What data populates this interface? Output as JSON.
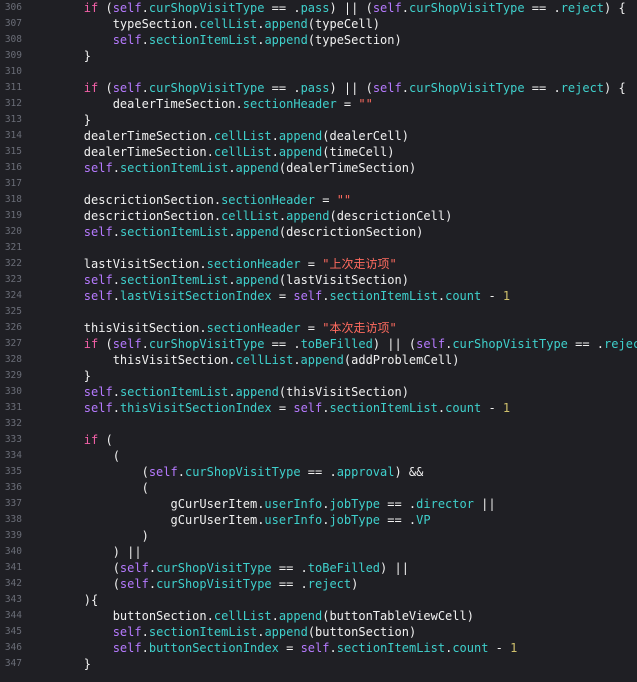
{
  "editor": {
    "colors": {
      "background": "#1f1f24",
      "line_number": "#6a6d77",
      "plain": "#f1f1f1",
      "keyword": "#f05fa6",
      "self": "#b67aff",
      "property": "#3fd0cc",
      "string": "#ff6b5f",
      "number": "#cfc06c"
    },
    "lines": [
      {
        "n": "306",
        "tokens": [
          [
            "plain",
            "        "
          ],
          [
            "kw",
            "if"
          ],
          [
            "plain",
            " ("
          ],
          [
            "self",
            "self"
          ],
          [
            "plain",
            "."
          ],
          [
            "prop",
            "curShopVisitType"
          ],
          [
            "plain",
            " == ."
          ],
          [
            "prop",
            "pass"
          ],
          [
            "plain",
            ") || ("
          ],
          [
            "self",
            "self"
          ],
          [
            "plain",
            "."
          ],
          [
            "prop",
            "curShopVisitType"
          ],
          [
            "plain",
            " == ."
          ],
          [
            "prop",
            "reject"
          ],
          [
            "plain",
            ") {"
          ]
        ]
      },
      {
        "n": "307",
        "tokens": [
          [
            "plain",
            "            typeSection."
          ],
          [
            "prop",
            "cellList"
          ],
          [
            "plain",
            "."
          ],
          [
            "prop",
            "append"
          ],
          [
            "plain",
            "(typeCell)"
          ]
        ]
      },
      {
        "n": "308",
        "tokens": [
          [
            "plain",
            "            "
          ],
          [
            "self",
            "self"
          ],
          [
            "plain",
            "."
          ],
          [
            "prop",
            "sectionItemList"
          ],
          [
            "plain",
            "."
          ],
          [
            "prop",
            "append"
          ],
          [
            "plain",
            "(typeSection)"
          ]
        ]
      },
      {
        "n": "309",
        "tokens": [
          [
            "plain",
            "        }"
          ]
        ]
      },
      {
        "n": "310",
        "tokens": []
      },
      {
        "n": "311",
        "tokens": [
          [
            "plain",
            "        "
          ],
          [
            "kw",
            "if"
          ],
          [
            "plain",
            " ("
          ],
          [
            "self",
            "self"
          ],
          [
            "plain",
            "."
          ],
          [
            "prop",
            "curShopVisitType"
          ],
          [
            "plain",
            " == ."
          ],
          [
            "prop",
            "pass"
          ],
          [
            "plain",
            ") || ("
          ],
          [
            "self",
            "self"
          ],
          [
            "plain",
            "."
          ],
          [
            "prop",
            "curShopVisitType"
          ],
          [
            "plain",
            " == ."
          ],
          [
            "prop",
            "reject"
          ],
          [
            "plain",
            ") {"
          ]
        ]
      },
      {
        "n": "312",
        "tokens": [
          [
            "plain",
            "            dealerTimeSection."
          ],
          [
            "prop",
            "sectionHeader"
          ],
          [
            "plain",
            " = "
          ],
          [
            "str",
            "\"\""
          ]
        ]
      },
      {
        "n": "313",
        "tokens": [
          [
            "plain",
            "        }"
          ]
        ]
      },
      {
        "n": "314",
        "tokens": [
          [
            "plain",
            "        dealerTimeSection."
          ],
          [
            "prop",
            "cellList"
          ],
          [
            "plain",
            "."
          ],
          [
            "prop",
            "append"
          ],
          [
            "plain",
            "(dealerCell)"
          ]
        ]
      },
      {
        "n": "315",
        "tokens": [
          [
            "plain",
            "        dealerTimeSection."
          ],
          [
            "prop",
            "cellList"
          ],
          [
            "plain",
            "."
          ],
          [
            "prop",
            "append"
          ],
          [
            "plain",
            "(timeCell)"
          ]
        ]
      },
      {
        "n": "316",
        "tokens": [
          [
            "plain",
            "        "
          ],
          [
            "self",
            "self"
          ],
          [
            "plain",
            "."
          ],
          [
            "prop",
            "sectionItemList"
          ],
          [
            "plain",
            "."
          ],
          [
            "prop",
            "append"
          ],
          [
            "plain",
            "(dealerTimeSection)"
          ]
        ]
      },
      {
        "n": "317",
        "tokens": []
      },
      {
        "n": "318",
        "tokens": [
          [
            "plain",
            "        descrictionSection."
          ],
          [
            "prop",
            "sectionHeader"
          ],
          [
            "plain",
            " = "
          ],
          [
            "str",
            "\"\""
          ]
        ]
      },
      {
        "n": "319",
        "tokens": [
          [
            "plain",
            "        descrictionSection."
          ],
          [
            "prop",
            "cellList"
          ],
          [
            "plain",
            "."
          ],
          [
            "prop",
            "append"
          ],
          [
            "plain",
            "(descrictionCell)"
          ]
        ]
      },
      {
        "n": "320",
        "tokens": [
          [
            "plain",
            "        "
          ],
          [
            "self",
            "self"
          ],
          [
            "plain",
            "."
          ],
          [
            "prop",
            "sectionItemList"
          ],
          [
            "plain",
            "."
          ],
          [
            "prop",
            "append"
          ],
          [
            "plain",
            "(descrictionSection)"
          ]
        ]
      },
      {
        "n": "321",
        "tokens": []
      },
      {
        "n": "322",
        "tokens": [
          [
            "plain",
            "        lastVisitSection."
          ],
          [
            "prop",
            "sectionHeader"
          ],
          [
            "plain",
            " = "
          ],
          [
            "str",
            "\"上次走访项\""
          ]
        ]
      },
      {
        "n": "323",
        "tokens": [
          [
            "plain",
            "        "
          ],
          [
            "self",
            "self"
          ],
          [
            "plain",
            "."
          ],
          [
            "prop",
            "sectionItemList"
          ],
          [
            "plain",
            "."
          ],
          [
            "prop",
            "append"
          ],
          [
            "plain",
            "(lastVisitSection)"
          ]
        ]
      },
      {
        "n": "324",
        "tokens": [
          [
            "plain",
            "        "
          ],
          [
            "self",
            "self"
          ],
          [
            "plain",
            "."
          ],
          [
            "prop",
            "lastVisitSectionIndex"
          ],
          [
            "plain",
            " = "
          ],
          [
            "self",
            "self"
          ],
          [
            "plain",
            "."
          ],
          [
            "prop",
            "sectionItemList"
          ],
          [
            "plain",
            "."
          ],
          [
            "prop",
            "count"
          ],
          [
            "plain",
            " - "
          ],
          [
            "num",
            "1"
          ]
        ]
      },
      {
        "n": "325",
        "tokens": []
      },
      {
        "n": "326",
        "tokens": [
          [
            "plain",
            "        thisVisitSection."
          ],
          [
            "prop",
            "sectionHeader"
          ],
          [
            "plain",
            " = "
          ],
          [
            "str",
            "\"本次走访项\""
          ]
        ]
      },
      {
        "n": "327",
        "tokens": [
          [
            "plain",
            "        "
          ],
          [
            "kw",
            "if"
          ],
          [
            "plain",
            " ("
          ],
          [
            "self",
            "self"
          ],
          [
            "plain",
            "."
          ],
          [
            "prop",
            "curShopVisitType"
          ],
          [
            "plain",
            " == ."
          ],
          [
            "prop",
            "toBeFilled"
          ],
          [
            "plain",
            ") || ("
          ],
          [
            "self",
            "self"
          ],
          [
            "plain",
            "."
          ],
          [
            "prop",
            "curShopVisitType"
          ],
          [
            "plain",
            " == ."
          ],
          [
            "prop",
            "reject"
          ],
          [
            "plain",
            ") {"
          ]
        ]
      },
      {
        "n": "328",
        "tokens": [
          [
            "plain",
            "            thisVisitSection."
          ],
          [
            "prop",
            "cellList"
          ],
          [
            "plain",
            "."
          ],
          [
            "prop",
            "append"
          ],
          [
            "plain",
            "(addProblemCell)"
          ]
        ]
      },
      {
        "n": "329",
        "tokens": [
          [
            "plain",
            "        }"
          ]
        ]
      },
      {
        "n": "330",
        "tokens": [
          [
            "plain",
            "        "
          ],
          [
            "self",
            "self"
          ],
          [
            "plain",
            "."
          ],
          [
            "prop",
            "sectionItemList"
          ],
          [
            "plain",
            "."
          ],
          [
            "prop",
            "append"
          ],
          [
            "plain",
            "(thisVisitSection)"
          ]
        ]
      },
      {
        "n": "331",
        "tokens": [
          [
            "plain",
            "        "
          ],
          [
            "self",
            "self"
          ],
          [
            "plain",
            "."
          ],
          [
            "prop",
            "thisVisitSectionIndex"
          ],
          [
            "plain",
            " = "
          ],
          [
            "self",
            "self"
          ],
          [
            "plain",
            "."
          ],
          [
            "prop",
            "sectionItemList"
          ],
          [
            "plain",
            "."
          ],
          [
            "prop",
            "count"
          ],
          [
            "plain",
            " - "
          ],
          [
            "num",
            "1"
          ]
        ]
      },
      {
        "n": "332",
        "tokens": []
      },
      {
        "n": "333",
        "tokens": [
          [
            "plain",
            "        "
          ],
          [
            "kw",
            "if"
          ],
          [
            "plain",
            " ("
          ]
        ]
      },
      {
        "n": "334",
        "tokens": [
          [
            "plain",
            "            ("
          ]
        ]
      },
      {
        "n": "335",
        "tokens": [
          [
            "plain",
            "                ("
          ],
          [
            "self",
            "self"
          ],
          [
            "plain",
            "."
          ],
          [
            "prop",
            "curShopVisitType"
          ],
          [
            "plain",
            " == ."
          ],
          [
            "prop",
            "approval"
          ],
          [
            "plain",
            ") &&"
          ]
        ]
      },
      {
        "n": "336",
        "tokens": [
          [
            "plain",
            "                ("
          ]
        ]
      },
      {
        "n": "337",
        "tokens": [
          [
            "plain",
            "                    gCurUserItem."
          ],
          [
            "prop",
            "userInfo"
          ],
          [
            "plain",
            "."
          ],
          [
            "prop",
            "jobType"
          ],
          [
            "plain",
            " == ."
          ],
          [
            "prop",
            "director"
          ],
          [
            "plain",
            " ||"
          ]
        ]
      },
      {
        "n": "338",
        "tokens": [
          [
            "plain",
            "                    gCurUserItem."
          ],
          [
            "prop",
            "userInfo"
          ],
          [
            "plain",
            "."
          ],
          [
            "prop",
            "jobType"
          ],
          [
            "plain",
            " == ."
          ],
          [
            "prop",
            "VP"
          ]
        ]
      },
      {
        "n": "339",
        "tokens": [
          [
            "plain",
            "                )"
          ]
        ]
      },
      {
        "n": "340",
        "tokens": [
          [
            "plain",
            "            ) ||"
          ]
        ]
      },
      {
        "n": "341",
        "tokens": [
          [
            "plain",
            "            ("
          ],
          [
            "self",
            "self"
          ],
          [
            "plain",
            "."
          ],
          [
            "prop",
            "curShopVisitType"
          ],
          [
            "plain",
            " == ."
          ],
          [
            "prop",
            "toBeFilled"
          ],
          [
            "plain",
            ") ||"
          ]
        ]
      },
      {
        "n": "342",
        "tokens": [
          [
            "plain",
            "            ("
          ],
          [
            "self",
            "self"
          ],
          [
            "plain",
            "."
          ],
          [
            "prop",
            "curShopVisitType"
          ],
          [
            "plain",
            " == ."
          ],
          [
            "prop",
            "reject"
          ],
          [
            "plain",
            ")"
          ]
        ]
      },
      {
        "n": "343",
        "tokens": [
          [
            "plain",
            "        ){"
          ]
        ]
      },
      {
        "n": "344",
        "tokens": [
          [
            "plain",
            "            buttonSection."
          ],
          [
            "prop",
            "cellList"
          ],
          [
            "plain",
            "."
          ],
          [
            "prop",
            "append"
          ],
          [
            "plain",
            "(buttonTableViewCell)"
          ]
        ]
      },
      {
        "n": "345",
        "tokens": [
          [
            "plain",
            "            "
          ],
          [
            "self",
            "self"
          ],
          [
            "plain",
            "."
          ],
          [
            "prop",
            "sectionItemList"
          ],
          [
            "plain",
            "."
          ],
          [
            "prop",
            "append"
          ],
          [
            "plain",
            "(buttonSection)"
          ]
        ]
      },
      {
        "n": "346",
        "tokens": [
          [
            "plain",
            "            "
          ],
          [
            "self",
            "self"
          ],
          [
            "plain",
            "."
          ],
          [
            "prop",
            "buttonSectionIndex"
          ],
          [
            "plain",
            " = "
          ],
          [
            "self",
            "self"
          ],
          [
            "plain",
            "."
          ],
          [
            "prop",
            "sectionItemList"
          ],
          [
            "plain",
            "."
          ],
          [
            "prop",
            "count"
          ],
          [
            "plain",
            " - "
          ],
          [
            "num",
            "1"
          ]
        ]
      },
      {
        "n": "347",
        "tokens": [
          [
            "plain",
            "        }"
          ]
        ]
      }
    ]
  }
}
